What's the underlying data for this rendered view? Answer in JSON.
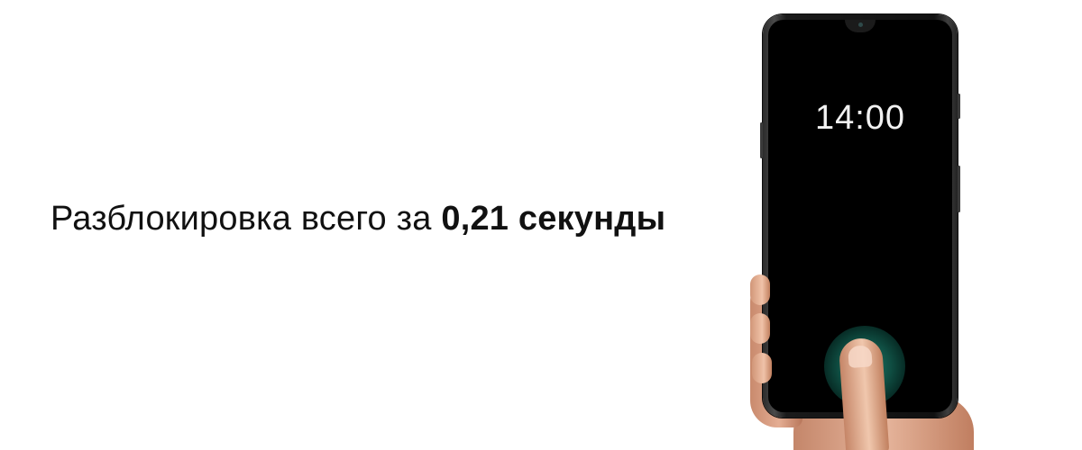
{
  "headline": {
    "normal_text": "Разблокировка всего за ",
    "bold_text": "0,21 секунды"
  },
  "phone": {
    "clock_text": "14:00"
  },
  "colors": {
    "background": "#ffffff",
    "text": "#111111",
    "screen": "#000000",
    "sensor_glow": "#1f8e78"
  }
}
